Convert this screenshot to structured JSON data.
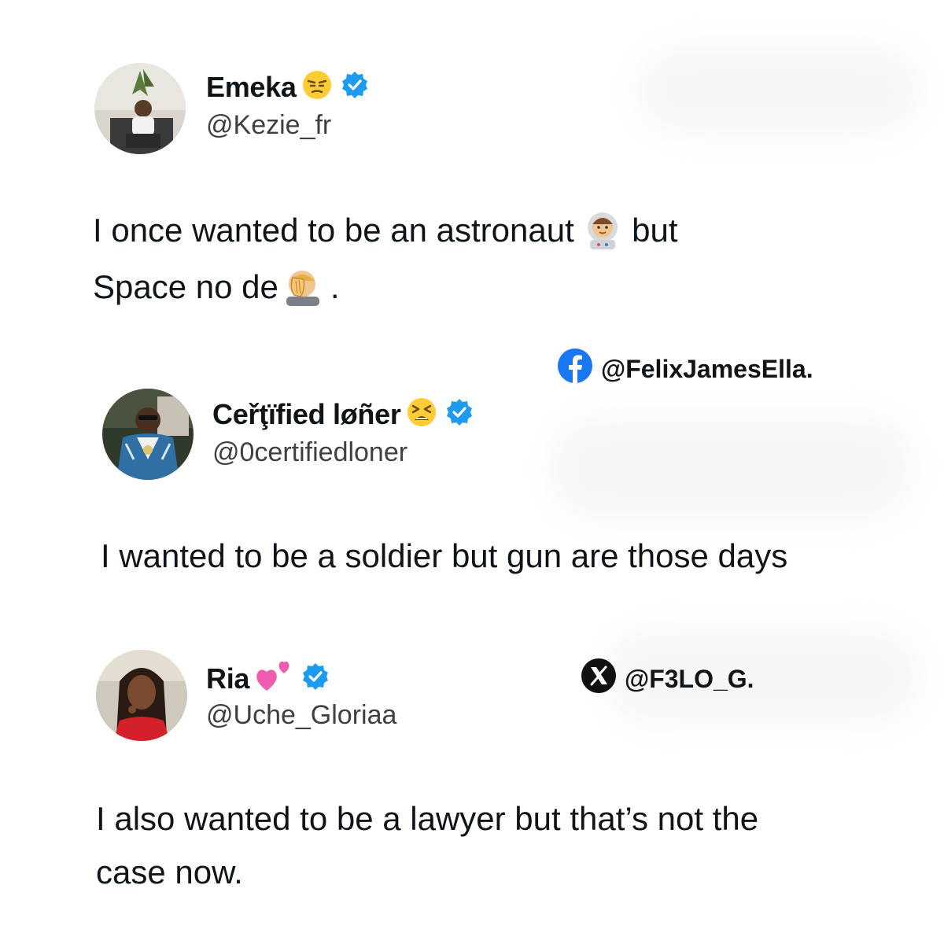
{
  "posts": [
    {
      "name": "Emeka",
      "name_emoji": "unamused-face-icon",
      "handle": "@Kezie_fr",
      "verified": true,
      "text_line1_a": "I once wanted to be an astronaut",
      "text_line1_b": "but",
      "text_line2_a": "Space no de",
      "text_line2_b": "."
    },
    {
      "name": "Cеřţïfied løñer",
      "name_emoji": "tired-face-icon",
      "handle": "@0certifiedloner",
      "verified": true,
      "text_line1": "I wanted to be a soldier but gun are those days"
    },
    {
      "name": "Ria",
      "name_emoji": "two-hearts-icon",
      "handle": "@Uche_Gloriaa",
      "verified": true,
      "text_line1": "I also wanted to be a lawyer but that’s not the",
      "text_line2": "case now."
    }
  ],
  "watermarks": [
    {
      "platform_icon": "facebook-icon",
      "text": "@FelixJamesElla."
    },
    {
      "platform_icon": "x-icon",
      "text": "@F3LO_G."
    }
  ],
  "colors": {
    "verified_blue": "#1d9bf0",
    "facebook_blue": "#1877f2",
    "text": "#0f1419",
    "handle": "#3d3f44"
  }
}
